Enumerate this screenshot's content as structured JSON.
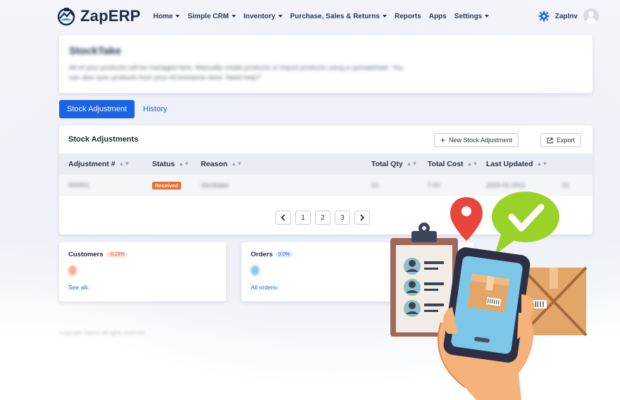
{
  "app": {
    "logo_text": "ZapERP",
    "menu": [
      {
        "label": "Home",
        "has_caret": true
      },
      {
        "label": "Simple CRM",
        "has_caret": true
      },
      {
        "label": "Inventory",
        "has_caret": true
      },
      {
        "label": "Purchase, Sales & Returns",
        "has_caret": true
      },
      {
        "label": "Reports",
        "has_caret": false
      },
      {
        "label": "Apps",
        "has_caret": false
      },
      {
        "label": "Settings",
        "has_caret": true
      }
    ],
    "user_name": "ZapInv"
  },
  "header": {
    "title": "StockTake",
    "description": "All of your products will be managed here. Manually create products or import products using a spreadsheet. You can also sync products from your eCommerce store. Need help?"
  },
  "tabs": {
    "active": "Stock Adjustment",
    "other": "History"
  },
  "adjustments": {
    "title": "Stock Adjustments",
    "new_button": "New Stock Adjustment",
    "export_button": "Export",
    "columns": [
      "Adjustment #",
      "Status",
      "Reason",
      "Total Qty",
      "Total Cost",
      "Last Updated"
    ],
    "rows": [
      {
        "number": "000001",
        "status": "Received",
        "reason": "Stocktake",
        "qty": "10",
        "cost": "7.50",
        "updated": "2023-01-2011",
        "extra": "01"
      }
    ],
    "pages": [
      "1",
      "2",
      "3"
    ]
  },
  "stats": {
    "customers": {
      "title": "Customers",
      "change": "-0.23%",
      "link": "See all"
    },
    "orders": {
      "title": "Orders",
      "change": "0.0%",
      "link": "All orders"
    }
  },
  "footer_text": "Copyright ZapInv. All rights reserved.",
  "colors": {
    "primary": "#1a62e8",
    "received_badge": "#f26b2c",
    "illustration_green": "#9bd22a",
    "illustration_red": "#e8453c"
  },
  "icons": {
    "settings": "gear-icon",
    "user": "avatar-icon",
    "new": "plus-icon",
    "export": "export-icon",
    "sort": "sort-icon"
  }
}
